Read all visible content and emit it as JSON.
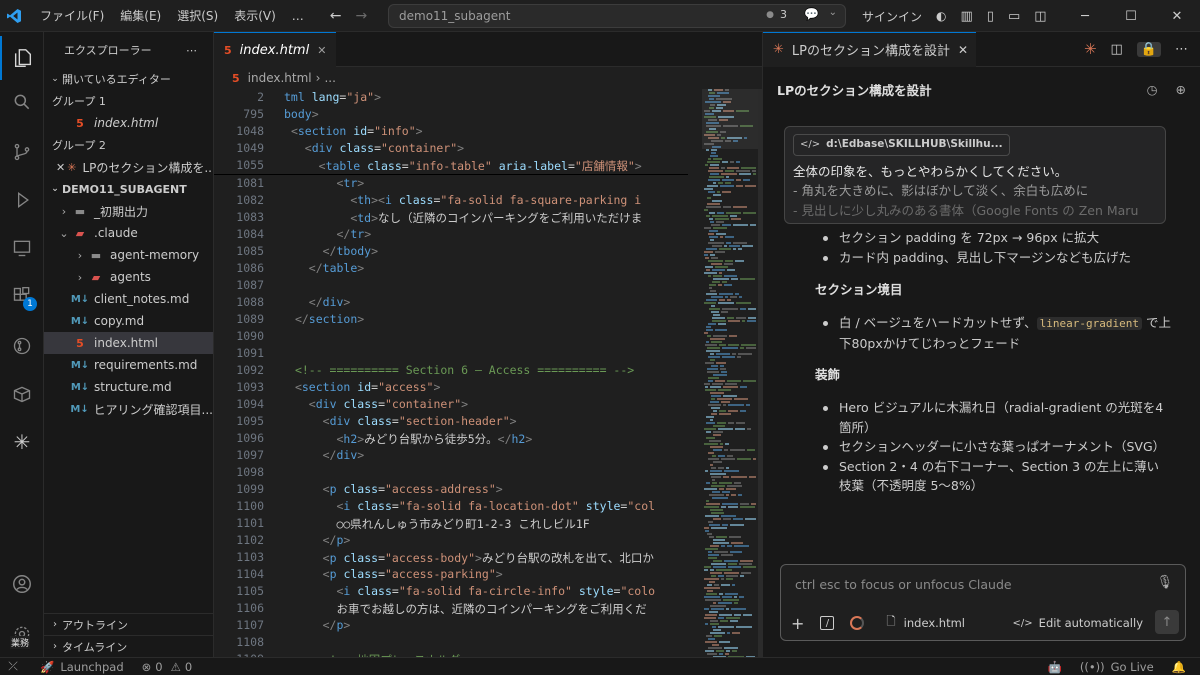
{
  "titlebar": {
    "menus": [
      "ファイル(F)",
      "編集(E)",
      "選択(S)",
      "表示(V)",
      "…"
    ],
    "search_text": "demo11_subagent",
    "count": "3",
    "signin": "サインイン"
  },
  "sidebar": {
    "title": "エクスプローラー",
    "open_editors": "開いているエディター",
    "group1": "グループ 1",
    "group1_file": "index.html",
    "group2": "グループ 2",
    "group2_file": "LPのセクション構成を...",
    "project": "DEMO11_SUBAGENT",
    "tree": [
      {
        "label": "_初期出力",
        "kind": "folder",
        "depth": 1,
        "arrow": "›"
      },
      {
        "label": ".claude",
        "kind": "claude",
        "depth": 1,
        "arrow": "⌄"
      },
      {
        "label": "agent-memory",
        "kind": "folder",
        "depth": 2,
        "arrow": "›"
      },
      {
        "label": "agents",
        "kind": "agents",
        "depth": 2,
        "arrow": "›"
      },
      {
        "label": "client_notes.md",
        "kind": "md",
        "depth": 1,
        "arrow": ""
      },
      {
        "label": "copy.md",
        "kind": "md",
        "depth": 1,
        "arrow": ""
      },
      {
        "label": "index.html",
        "kind": "html",
        "depth": 1,
        "arrow": ""
      },
      {
        "label": "requirements.md",
        "kind": "md",
        "depth": 1,
        "arrow": ""
      },
      {
        "label": "structure.md",
        "kind": "md",
        "depth": 1,
        "arrow": ""
      },
      {
        "label": "ヒアリング確認項目...",
        "kind": "md",
        "depth": 1,
        "arrow": ""
      }
    ],
    "outline": "アウトライン",
    "timeline": "タイムライン"
  },
  "activity": {
    "badge": "1",
    "account_label": "業務"
  },
  "editor": {
    "tab": "index.html",
    "breadcrumb": [
      "index.html",
      "..."
    ]
  },
  "code_sticky": [
    {
      "n": "2",
      "html": "<span class=\"t\">tml</span> <span class=\"a\">lang</span>=<span class=\"s\">\"ja\"</span><span class=\"p\">></span>"
    },
    {
      "n": "795",
      "html": "<span class=\"t\">body</span><span class=\"p\">></span>"
    },
    {
      "n": "1048",
      "html": " <span class=\"p\">&lt;</span><span class=\"t\">section</span> <span class=\"a\">id</span>=<span class=\"s\">\"info\"</span><span class=\"p\">></span>"
    },
    {
      "n": "1049",
      "html": "   <span class=\"p\">&lt;</span><span class=\"t\">div</span> <span class=\"a\">class</span>=<span class=\"s\">\"container\"</span><span class=\"p\">></span>"
    },
    {
      "n": "1055",
      "html": "     <span class=\"p\">&lt;</span><span class=\"t\">table</span> <span class=\"a\">class</span>=<span class=\"s\">\"info-table\"</span> <span class=\"a\">aria-label</span>=<span class=\"s\">\"店舗情報\"</span><span class=\"p\">></span>"
    }
  ],
  "code_lines": [
    {
      "n": "1081",
      "html": "       <span class=\"p\">&lt;</span><span class=\"t\">tr</span><span class=\"p\">></span>"
    },
    {
      "n": "1082",
      "html": "         <span class=\"p\">&lt;</span><span class=\"t\">th</span><span class=\"p\">>&lt;</span><span class=\"t\">i</span> <span class=\"a\">class</span>=<span class=\"s\">\"fa-solid fa-square-parking i</span>"
    },
    {
      "n": "1083",
      "html": "         <span class=\"p\">&lt;</span><span class=\"t\">td</span><span class=\"p\">></span>なし（近隣のコインパーキングをご利用いただけま"
    },
    {
      "n": "1084",
      "html": "       <span class=\"p\">&lt;/</span><span class=\"t\">tr</span><span class=\"p\">></span>"
    },
    {
      "n": "1085",
      "html": "     <span class=\"p\">&lt;/</span><span class=\"t\">tbody</span><span class=\"p\">></span>"
    },
    {
      "n": "1086",
      "html": "   <span class=\"p\">&lt;/</span><span class=\"t\">table</span><span class=\"p\">></span>"
    },
    {
      "n": "1087",
      "html": ""
    },
    {
      "n": "1088",
      "html": "   <span class=\"p\">&lt;/</span><span class=\"t\">div</span><span class=\"p\">></span>"
    },
    {
      "n": "1089",
      "html": " <span class=\"p\">&lt;/</span><span class=\"t\">section</span><span class=\"p\">></span>"
    },
    {
      "n": "1090",
      "html": ""
    },
    {
      "n": "1091",
      "html": ""
    },
    {
      "n": "1092",
      "html": " <span class=\"c\">&lt;!-- ========== Section 6 — Access ========== --></span>"
    },
    {
      "n": "1093",
      "html": " <span class=\"p\">&lt;</span><span class=\"t\">section</span> <span class=\"a\">id</span>=<span class=\"s\">\"access\"</span><span class=\"p\">></span>"
    },
    {
      "n": "1094",
      "html": "   <span class=\"p\">&lt;</span><span class=\"t\">div</span> <span class=\"a\">class</span>=<span class=\"s\">\"container\"</span><span class=\"p\">></span>"
    },
    {
      "n": "1095",
      "html": "     <span class=\"p\">&lt;</span><span class=\"t\">div</span> <span class=\"a\">class</span>=<span class=\"s\">\"section-header\"</span><span class=\"p\">></span>"
    },
    {
      "n": "1096",
      "html": "       <span class=\"p\">&lt;</span><span class=\"t\">h2</span><span class=\"p\">></span>みどり台駅から徒歩5分。<span class=\"p\">&lt;/</span><span class=\"t\">h2</span><span class=\"p\">></span>"
    },
    {
      "n": "1097",
      "html": "     <span class=\"p\">&lt;/</span><span class=\"t\">div</span><span class=\"p\">></span>"
    },
    {
      "n": "1098",
      "html": ""
    },
    {
      "n": "1099",
      "html": "     <span class=\"p\">&lt;</span><span class=\"t\">p</span> <span class=\"a\">class</span>=<span class=\"s\">\"access-address\"</span><span class=\"p\">></span>"
    },
    {
      "n": "1100",
      "html": "       <span class=\"p\">&lt;</span><span class=\"t\">i</span> <span class=\"a\">class</span>=<span class=\"s\">\"fa-solid fa-location-dot\"</span> <span class=\"a\">style</span>=<span class=\"s\">\"col</span>"
    },
    {
      "n": "1101",
      "html": "       ○○県れんしゅう市みどり町1-2-3 これしビル1F"
    },
    {
      "n": "1102",
      "html": "     <span class=\"p\">&lt;/</span><span class=\"t\">p</span><span class=\"p\">></span>"
    },
    {
      "n": "1103",
      "html": "     <span class=\"p\">&lt;</span><span class=\"t\">p</span> <span class=\"a\">class</span>=<span class=\"s\">\"access-body\"</span><span class=\"p\">></span>みどり台駅の改札を出て、北口か"
    },
    {
      "n": "1104",
      "html": "     <span class=\"p\">&lt;</span><span class=\"t\">p</span> <span class=\"a\">class</span>=<span class=\"s\">\"access-parking\"</span><span class=\"p\">></span>"
    },
    {
      "n": "1105",
      "html": "       <span class=\"p\">&lt;</span><span class=\"t\">i</span> <span class=\"a\">class</span>=<span class=\"s\">\"fa-solid fa-circle-info\"</span> <span class=\"a\">style</span>=<span class=\"s\">\"colo</span>"
    },
    {
      "n": "1106",
      "html": "       お車でお越しの方は、近隣のコインパーキングをご利用くだ"
    },
    {
      "n": "1107",
      "html": "     <span class=\"p\">&lt;/</span><span class=\"t\">p</span><span class=\"p\">></span>"
    },
    {
      "n": "1108",
      "html": ""
    },
    {
      "n": "1109",
      "html": "     <span class=\"c\">&lt;!-- 地図プレースホルダー --></span>"
    }
  ],
  "panel": {
    "tab": "LPのセクション構成を設計",
    "header": "LPのセクション構成を設計",
    "quote_chip": "d:\\Edbase\\SKILLHUB\\Skillhu...",
    "quote_line1": "全体の印象を、もっとやわらかくしてください。",
    "quote_line2": "- 角丸を大きめに、影はぼかして淡く、余白も広めに",
    "quote_line3": "- 見出しに少し丸みのある書体（Google Fonts の Zen Maru",
    "bullets_top": [
      "セクション padding を 72px → 96px に拡大",
      "カード内 padding、見出し下マージンなども広げた"
    ],
    "heading_border": "セクション境目",
    "border_pre": "白 / ベージュをハードカットせず、",
    "border_code": "linear-gradient",
    "border_post": " で上下80pxかけてじわっとフェード",
    "heading_deco": "装飾",
    "bullets_deco": [
      "Hero ビジュアルに木漏れ日（radial-gradient の光斑を4箇所）",
      "セクションヘッダーに小さな葉っぱオーナメント（SVG）",
      "Section 2・4 の右下コーナー、Section 3 の左上に薄い枝葉（不透明度 5〜8%）"
    ],
    "input_placeholder": "ctrl esc to focus or unfocus Claude",
    "file_ref": "index.html",
    "edit_mode": "Edit automatically"
  },
  "statusbar": {
    "launchpad": "Launchpad",
    "errors": "0",
    "warnings": "0",
    "golive": "Go Live"
  }
}
